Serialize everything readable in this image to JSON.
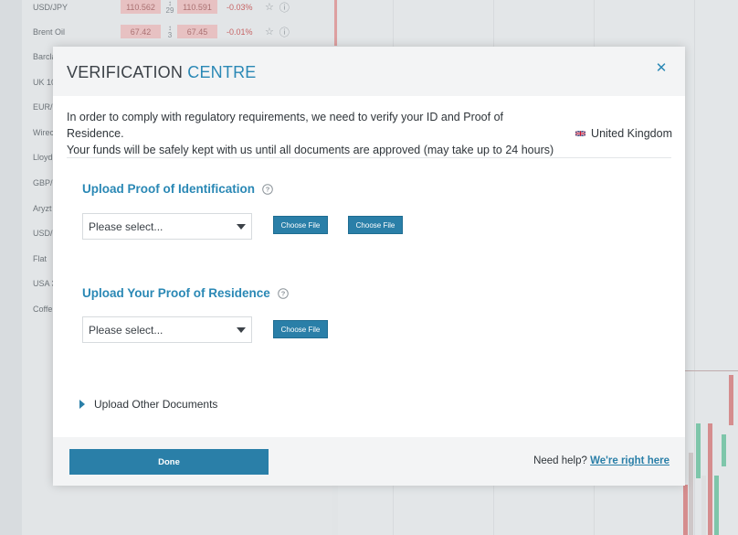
{
  "background": {
    "watchlist": [
      {
        "symbol": "USD/JPY",
        "sell": "110.562",
        "spread": "29",
        "buy": "110.591",
        "change": "-0.03%"
      },
      {
        "symbol": "Brent Oil",
        "sell": "67.42",
        "spread": "3",
        "buy": "67.45",
        "change": "-0.01%"
      },
      {
        "symbol": "Barcla"
      },
      {
        "symbol": "UK 10"
      },
      {
        "symbol": "EUR/"
      },
      {
        "symbol": "Wirec"
      },
      {
        "symbol": "Lloyd"
      },
      {
        "symbol": "GBP/"
      },
      {
        "symbol": "Aryzt"
      },
      {
        "symbol": "USD/"
      },
      {
        "symbol": "Flat"
      },
      {
        "symbol": "USA 3"
      },
      {
        "symbol": "Coffe"
      }
    ],
    "icons": {
      "star": "star-icon",
      "info": "info-icon"
    },
    "colors": {
      "sell": "#f4c9c9",
      "negative": "#d06060",
      "bull": "#7fcfae",
      "bear": "#e08f8f"
    }
  },
  "modal": {
    "title_main": "VERIFICATION",
    "title_accent": "CENTRE",
    "close_icon": "close-icon",
    "intro_line1": "In order to comply with regulatory requirements, we need to verify your ID and Proof of Residence.",
    "intro_line2": "Your funds will be safely kept with us until all documents are approved (may take up to 24 hours)",
    "country": "United Kingdom",
    "country_flag": "uk-flag-icon",
    "sections": [
      {
        "title": "Upload Proof of Identification",
        "select_value": "Please select...",
        "buttons": [
          "Choose File",
          "Choose File"
        ]
      },
      {
        "title": "Upload Your Proof of Residence",
        "select_value": "Please select...",
        "buttons": [
          "Choose File"
        ]
      }
    ],
    "other_documents": "Upload Other Documents",
    "footer": {
      "done_label": "Done",
      "help_text": "Need help?",
      "help_link": "We're right here"
    },
    "accent_color": "#2a88b5",
    "button_color": "#2a7fa8"
  }
}
